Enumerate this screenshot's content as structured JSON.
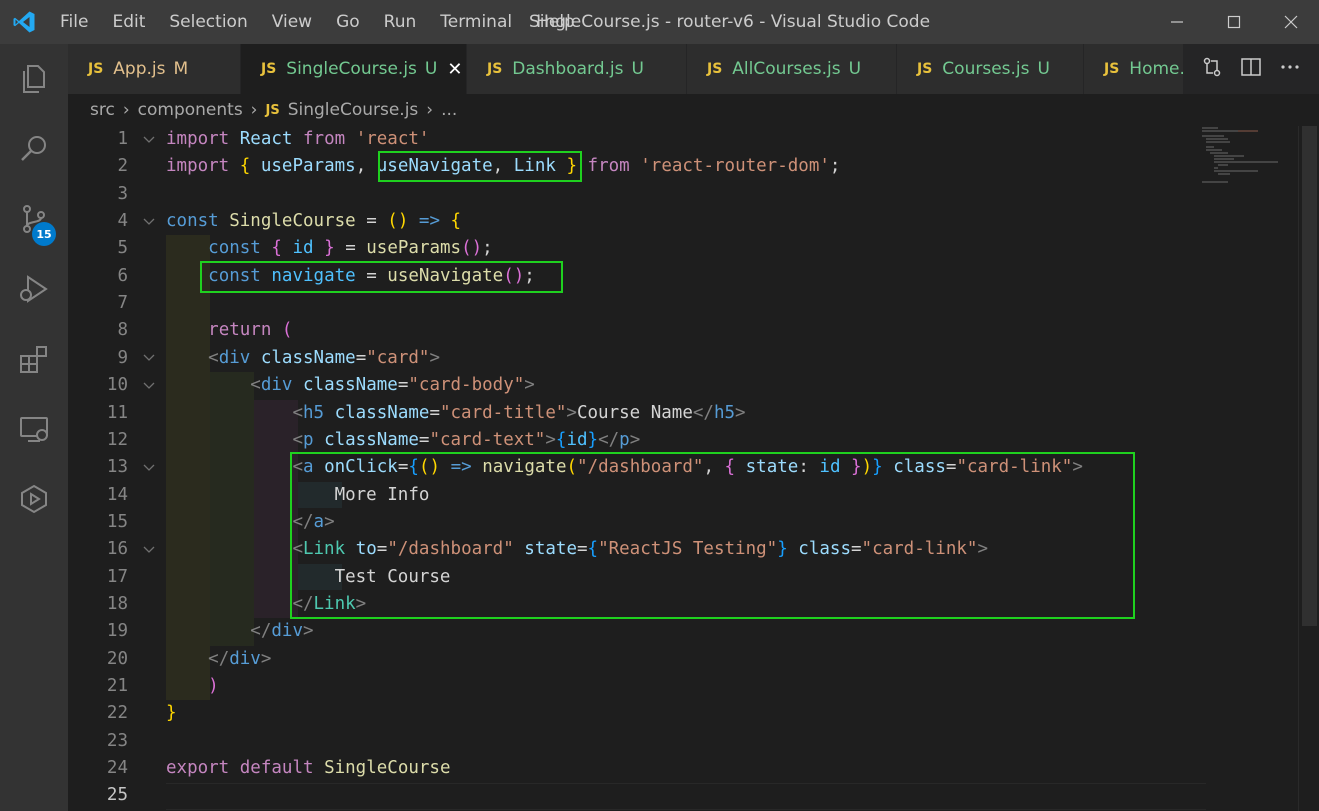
{
  "titlebar": {
    "menu": [
      "File",
      "Edit",
      "Selection",
      "View",
      "Go",
      "Run",
      "Terminal",
      "Help"
    ],
    "title": "SingleCourse.js - router-v6 - Visual Studio Code"
  },
  "activity": {
    "icons": [
      "explorer-icon",
      "search-icon",
      "source-control-icon",
      "run-debug-icon",
      "extensions-icon",
      "remote-explorer-icon",
      "testing-icon"
    ],
    "scm_badge": "15"
  },
  "tabs": [
    {
      "icon": "JS",
      "name": "App.js",
      "status": "M",
      "active": false
    },
    {
      "icon": "JS",
      "name": "SingleCourse.js",
      "status": "U",
      "active": true
    },
    {
      "icon": "JS",
      "name": "Dashboard.js",
      "status": "U",
      "active": false
    },
    {
      "icon": "JS",
      "name": "AllCourses.js",
      "status": "U",
      "active": false
    },
    {
      "icon": "JS",
      "name": "Courses.js",
      "status": "U",
      "active": false
    },
    {
      "icon": "JS",
      "name": "Home.j",
      "status": "",
      "active": false
    }
  ],
  "breadcrumb": {
    "parts": [
      "src",
      "components"
    ],
    "file_icon": "JS",
    "file": "SingleCourse.js",
    "ellipsis": "..."
  },
  "editor": {
    "line_numbers": [
      "1",
      "2",
      "3",
      "4",
      "5",
      "6",
      "7",
      "8",
      "9",
      "10",
      "11",
      "12",
      "13",
      "14",
      "15",
      "16",
      "17",
      "18",
      "19",
      "20",
      "21",
      "22",
      "23",
      "24",
      "25"
    ],
    "current_line": "25"
  },
  "colors": {
    "highlight_box": "#1fd11f",
    "accent": "#007acc"
  }
}
